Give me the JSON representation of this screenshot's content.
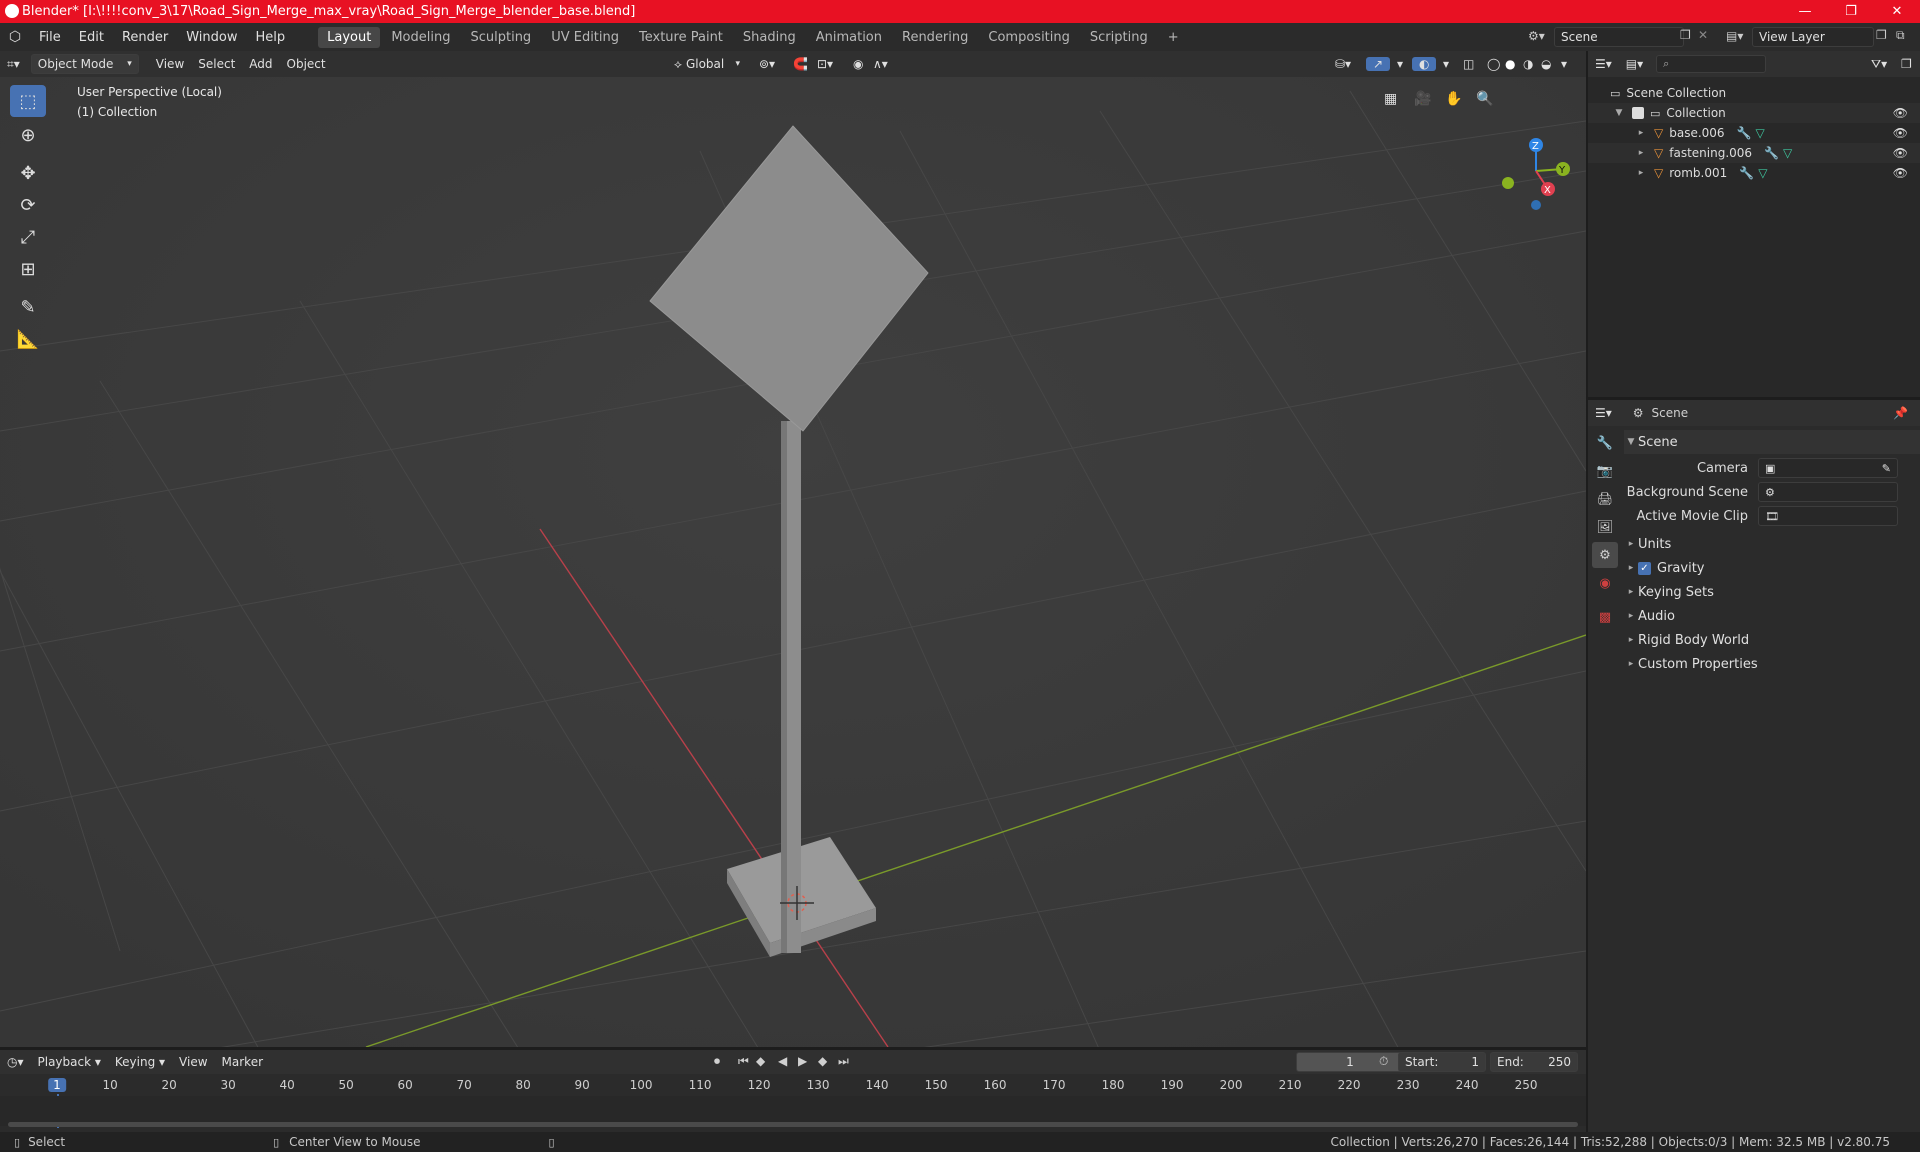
{
  "window": {
    "title": "Blender* [I:\\!!!!conv_3\\17\\Road_Sign_Merge_max_vray\\Road_Sign_Merge_blender_base.blend]",
    "minimize": "—",
    "maximize": "❐",
    "close": "✕"
  },
  "menu": [
    "File",
    "Edit",
    "Render",
    "Window",
    "Help"
  ],
  "workspaces": [
    "Layout",
    "Modeling",
    "Sculpting",
    "UV Editing",
    "Texture Paint",
    "Shading",
    "Animation",
    "Rendering",
    "Compositing",
    "Scripting"
  ],
  "active_workspace": "Layout",
  "add_workspace": "+",
  "scene_selector": {
    "value": "Scene"
  },
  "view_layer_selector": {
    "value": "View Layer"
  },
  "viewport": {
    "mode": "Object Mode",
    "menus": [
      "View",
      "Select",
      "Add",
      "Object"
    ],
    "orientation": "Global",
    "overlay_line1": "User Perspective (Local)",
    "overlay_line2": "(1) Collection",
    "gizmo": {
      "z": "Z",
      "y": "Y",
      "x": "X"
    }
  },
  "outliner": {
    "search_placeholder": "",
    "root": "Scene Collection",
    "collection": "Collection",
    "objects": [
      "base.006",
      "fastening.006",
      "romb.001"
    ]
  },
  "properties": {
    "context": "Scene",
    "panel": "Scene",
    "fields": [
      {
        "label": "Camera",
        "value": ""
      },
      {
        "label": "Background Scene",
        "value": ""
      },
      {
        "label": "Active Movie Clip",
        "value": ""
      }
    ],
    "sections": [
      "Units",
      "Gravity",
      "Keying Sets",
      "Audio",
      "Rigid Body World",
      "Custom Properties"
    ],
    "gravity_checked": true
  },
  "timeline": {
    "menus": [
      "Playback",
      "Keying",
      "View",
      "Marker"
    ],
    "current_frame": "1",
    "start_label": "Start:",
    "start": "1",
    "end_label": "End:",
    "end": "250",
    "ticks": [
      "1",
      "10",
      "20",
      "30",
      "40",
      "50",
      "60",
      "70",
      "80",
      "90",
      "100",
      "110",
      "120",
      "130",
      "140",
      "150",
      "160",
      "170",
      "180",
      "190",
      "200",
      "210",
      "220",
      "230",
      "240",
      "250"
    ]
  },
  "status": {
    "left1": "Select",
    "left2": "Center View to Mouse",
    "right": "Collection | Verts:26,270 | Faces:26,144 | Tris:52,288 | Objects:0/3 | Mem: 32.5 MB | v2.80.75"
  },
  "colors": {
    "title_bar": "#e81123",
    "active_tool": "#4772b3",
    "axis_x": "#e04050",
    "axis_y": "#8ab320",
    "axis_z": "#2f86e6",
    "orange_mesh": "#e8923a"
  }
}
